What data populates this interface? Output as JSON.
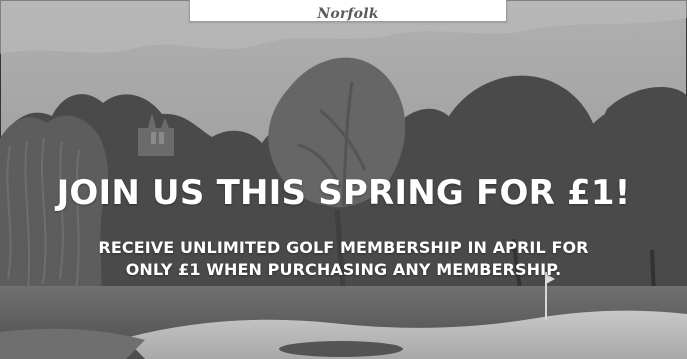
{
  "header": {
    "location": "Norfolk"
  },
  "promo": {
    "headline": "JOIN US THIS SPRING FOR £1!",
    "subheadline_line_1": "RECEIVE UNLIMITED GOLF MEMBERSHIP IN APRIL FOR",
    "subheadline_line_2": "ONLY £1 WHEN PURCHASING ANY MEMBERSHIP."
  },
  "image": {
    "style": "grayscale",
    "subject": "golf-course"
  }
}
